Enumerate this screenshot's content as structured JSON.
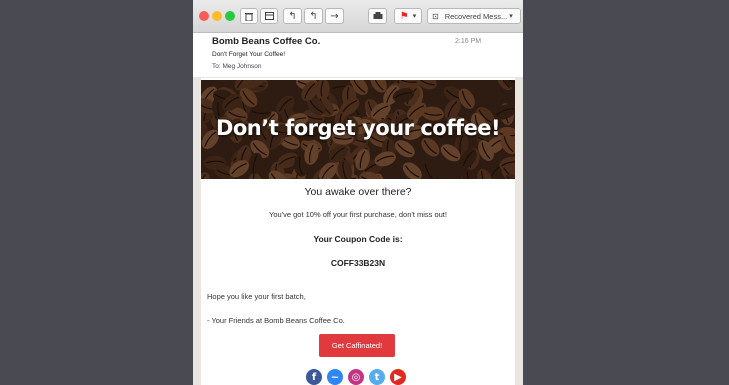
{
  "window": {
    "toolbar": {
      "delete_icon": "trash-icon",
      "archive_icon": "archive-icon",
      "mailbox_label": "Recovered Mess..."
    }
  },
  "email": {
    "sender": "Bomb Beans Coffee Co.",
    "time": "2:16 PM",
    "subject": "Don't Forget Your Coffee!",
    "to_label": "To:",
    "to_name": "Meg Johnson"
  },
  "content": {
    "hero_title": "Don’t forget your coffee!",
    "greeting": "You awake over there?",
    "offer": "You've got 10% off your first purchase, don't miss out!",
    "coupon_label": "Your Coupon Code is:",
    "coupon_code": "COFF33B23N",
    "closing_line": "Hope you like your first batch,",
    "signature": "- Your Friends at Bomb Beans Coffee Co.",
    "cta_label": "Get Caffinated!"
  },
  "social": [
    {
      "name": "facebook",
      "color": "#3b5998",
      "glyph": "f"
    },
    {
      "name": "messenger",
      "color": "#2f86f6",
      "glyph": "~"
    },
    {
      "name": "instagram",
      "color": "#c13584",
      "glyph": "◎"
    },
    {
      "name": "twitter",
      "color": "#55acee",
      "glyph": "t"
    },
    {
      "name": "youtube",
      "color": "#e02a20",
      "glyph": "▶"
    }
  ]
}
